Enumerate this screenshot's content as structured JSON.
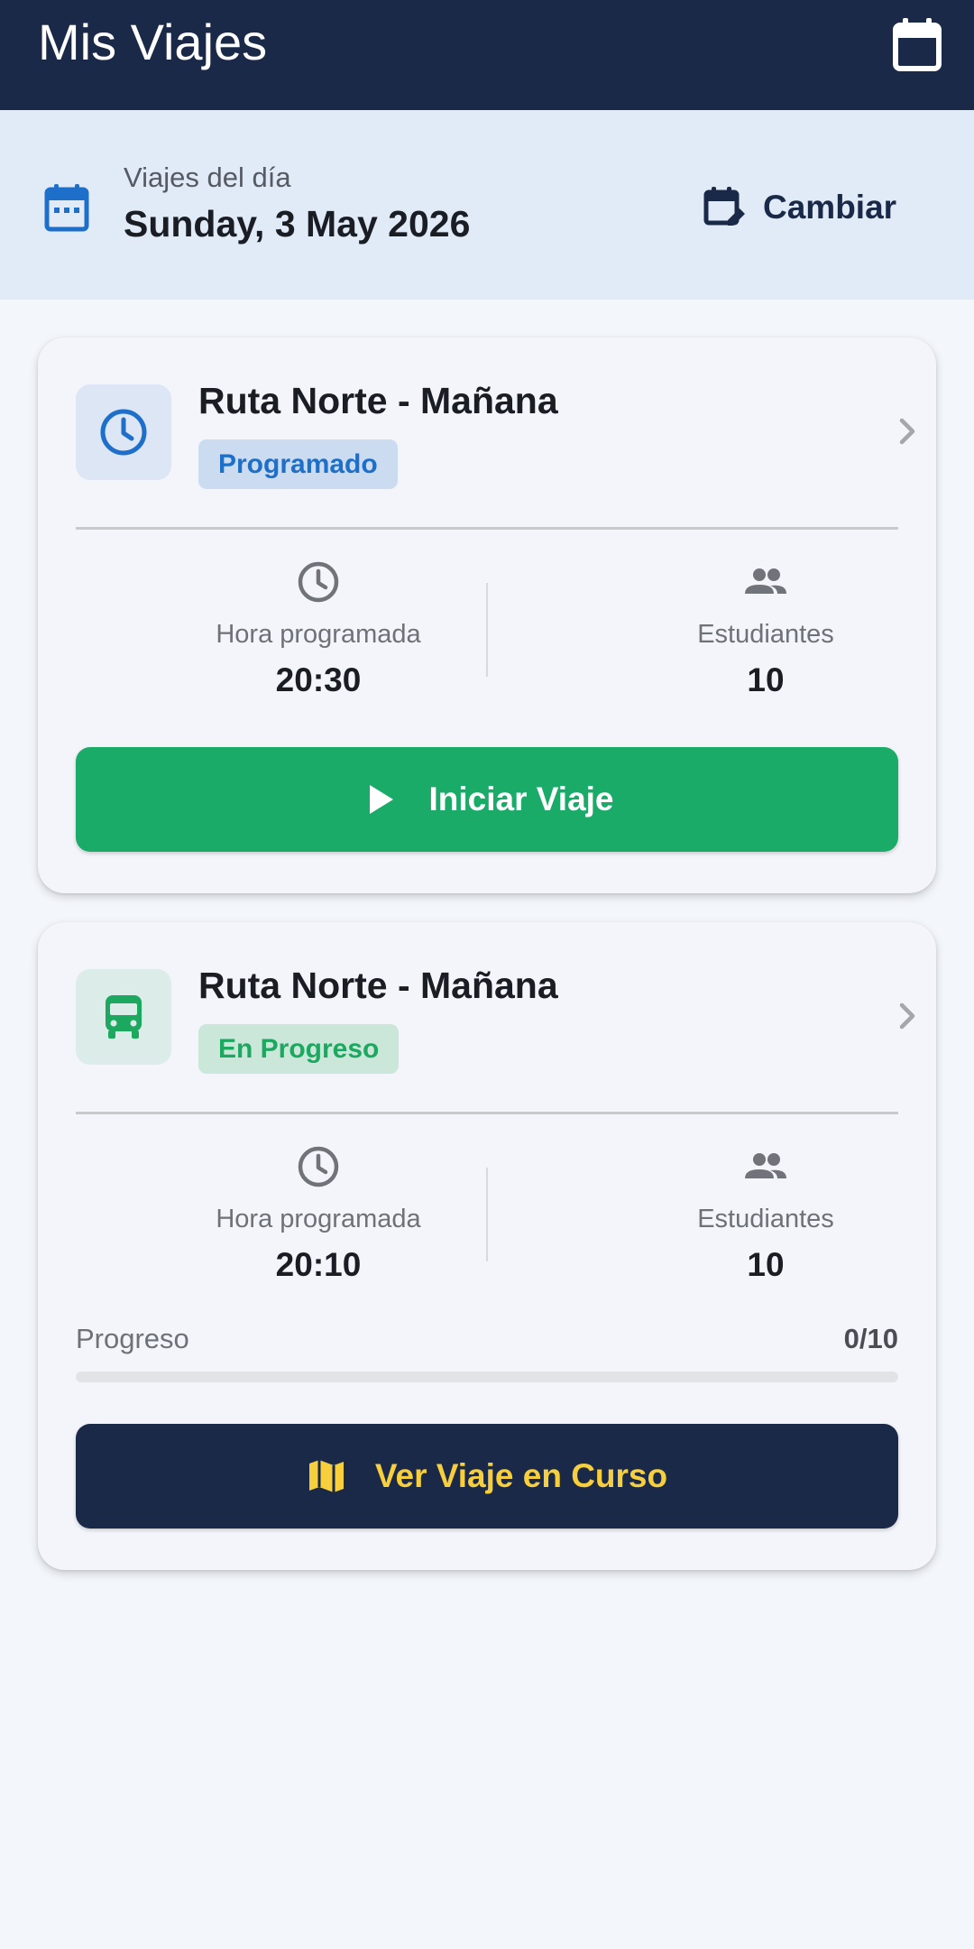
{
  "appbar": {
    "title": "Mis Viajes",
    "icon": "calendar-icon"
  },
  "date_bar": {
    "label": "Viajes del día",
    "date": "Sunday, 3 May 2026",
    "change_label": "Cambiar",
    "icon": "calendar-month-icon",
    "change_icon": "edit-calendar-icon"
  },
  "trips": [
    {
      "route": "Ruta Norte - Mañana",
      "status": "Programado",
      "status_icon": "clock-icon",
      "time_label": "Hora programada",
      "time": "20:30",
      "students_label": "Estudiantes",
      "students": "10",
      "action_label": "Iniciar Viaje",
      "action_icon": "play-icon"
    },
    {
      "route": "Ruta Norte - Mañana",
      "status": "En Progreso",
      "status_icon": "bus-icon",
      "time_label": "Hora programada",
      "time": "20:10",
      "students_label": "Estudiantes",
      "students": "10",
      "progress_label": "Progreso",
      "progress_text": "0/10",
      "progress_fraction": 0,
      "action_label": "Ver Viaje en Curso",
      "action_icon": "map-icon"
    }
  ],
  "colors": {
    "navy": "#1a2948",
    "green": "#1aab68",
    "blue": "#1d6fc9",
    "yellow": "#f7cf3d",
    "datebar_bg": "#e1ebf7"
  }
}
